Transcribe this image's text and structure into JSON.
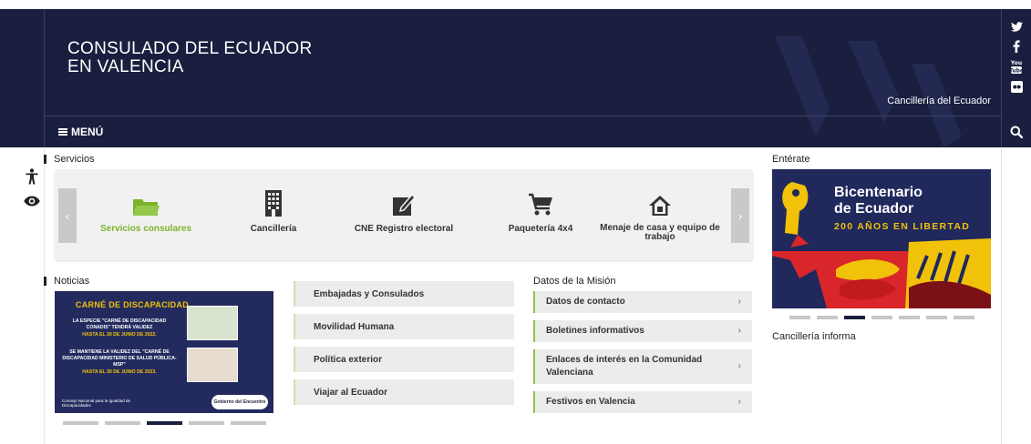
{
  "header": {
    "site_title_line1": "CONSULADO DEL ECUADOR",
    "site_title_line2": "EN VALENCIA",
    "cancilleria_link": "Cancillería del Ecuador",
    "menu_label": "MENÚ",
    "social_icons": [
      "twitter-icon",
      "facebook-icon",
      "youtube-icon",
      "flickr-icon"
    ]
  },
  "accessibility": {
    "icons": [
      "accessibility-person-icon",
      "eye-icon"
    ]
  },
  "servicios": {
    "title": "Servicios",
    "items": [
      {
        "label": "Servicios consulares",
        "icon": "folder-icon",
        "active": true
      },
      {
        "label": "Cancillería",
        "icon": "building-icon",
        "active": false
      },
      {
        "label": "CNE Registro electoral",
        "icon": "pencil-note-icon",
        "active": false
      },
      {
        "label": "Paquetería 4x4",
        "icon": "cart-icon",
        "active": false
      },
      {
        "label": "Menaje de casa y equipo de trabajo",
        "icon": "house-icon",
        "active": false
      }
    ],
    "prev_arrow": "‹",
    "next_arrow": "›"
  },
  "noticias": {
    "title": "Noticias",
    "slide": {
      "heading": "CARNÉ DE DISCAPACIDAD",
      "text1": "LA ESPECIE \"CARNÉ DE DISCAPACIDAD CONADIS\" TENDRÁ VALIDEZ",
      "text1b": "HASTA EL 30 DE JUNIO DE 2022.",
      "text2": "SE MANTIENE LA VALIDEZ DEL \"CARNÉ DE DISCAPACIDAD MINISTERIO DE SALUD PÚBLICA-MSP\"",
      "text2b": "HASTA EL 30 DE JUNIO DE 2023.",
      "footer": "Consejo Nacional para la Igualdad de Discapacidades",
      "logo_text": "Gobierno del Encuentro"
    },
    "dots": 5,
    "active_dot": 3
  },
  "links": [
    "Embajadas y Consulados",
    "Movilidad Humana",
    "Política exterior",
    "Viajar al Ecuador"
  ],
  "datos_mision": {
    "title": "Datos de la Misión",
    "items": [
      "Datos de contacto",
      "Boletines informativos",
      "Enlaces de interés en la Comunidad Valenciana",
      "Festivos en Valencia"
    ],
    "chevron": "›"
  },
  "enterate": {
    "title": "Entérate",
    "banner_line1": "Bicentenario",
    "banner_line2": "de Ecuador",
    "banner_line3": "200 AÑOS EN LIBERTAD",
    "dots": 7,
    "active_dot": 3
  },
  "cancilleria_informa": {
    "title": "Cancillería informa"
  },
  "colors": {
    "header_bg": "#1a1f3f",
    "accent_green": "#7cb32b",
    "banner_yellow": "#f2c10a",
    "banner_red": "#d8262a"
  }
}
